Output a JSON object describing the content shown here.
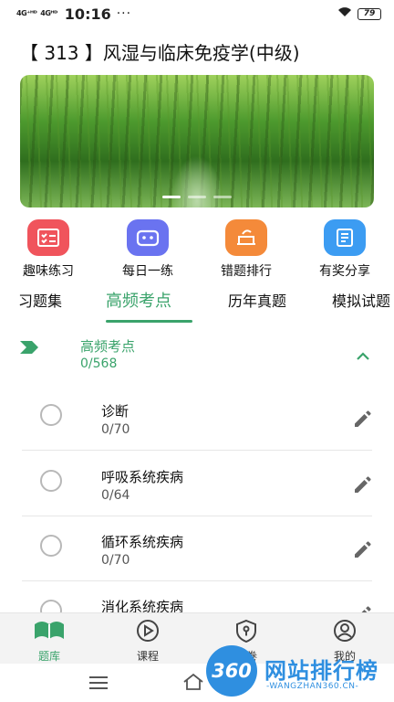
{
  "status_bar": {
    "signal_1": "4G⁺ᴴᴰ",
    "signal_2": "4Gᴴᴰ",
    "time": "10:16",
    "dots": "···",
    "battery": "79"
  },
  "header": {
    "title": "【 313 】风湿与临床免疫学(中级)"
  },
  "banner": {
    "dots": 3,
    "active_index": 0
  },
  "quick_actions": [
    {
      "label": "趣味练习",
      "icon": "checklist-icon",
      "color": "#f0545c"
    },
    {
      "label": "每日一练",
      "icon": "robot-icon",
      "color": "#6a73f0"
    },
    {
      "label": "错题排行",
      "icon": "ranking-icon",
      "color": "#f48a3a"
    },
    {
      "label": "有奖分享",
      "icon": "notebook-icon",
      "color": "#3c9cf2"
    }
  ],
  "tabs": [
    {
      "label": "习题集",
      "active": false
    },
    {
      "label": "高频考点",
      "active": true
    },
    {
      "label": "历年真题",
      "active": false
    },
    {
      "label": "模拟试题",
      "active": false
    }
  ],
  "section": {
    "title": "高频考点",
    "count": "0/568"
  },
  "items": [
    {
      "name": "诊断",
      "count": "0/70"
    },
    {
      "name": "呼吸系统疾病",
      "count": "0/64"
    },
    {
      "name": "循环系统疾病",
      "count": "0/70"
    },
    {
      "name": "消化系统疾病",
      "count": ""
    }
  ],
  "bottom_nav": [
    {
      "label": "题库",
      "icon": "book-icon",
      "active": true
    },
    {
      "label": "课程",
      "icon": "play-icon",
      "active": false
    },
    {
      "label": "密卷",
      "icon": "shield-key-icon",
      "active": false
    },
    {
      "label": "我的",
      "icon": "user-icon",
      "active": false
    }
  ],
  "watermark": {
    "logo": "360",
    "text": "网站排行榜",
    "sub": "-WANGZHAN360.CN-"
  },
  "colors": {
    "accent": "#3aa36b"
  }
}
